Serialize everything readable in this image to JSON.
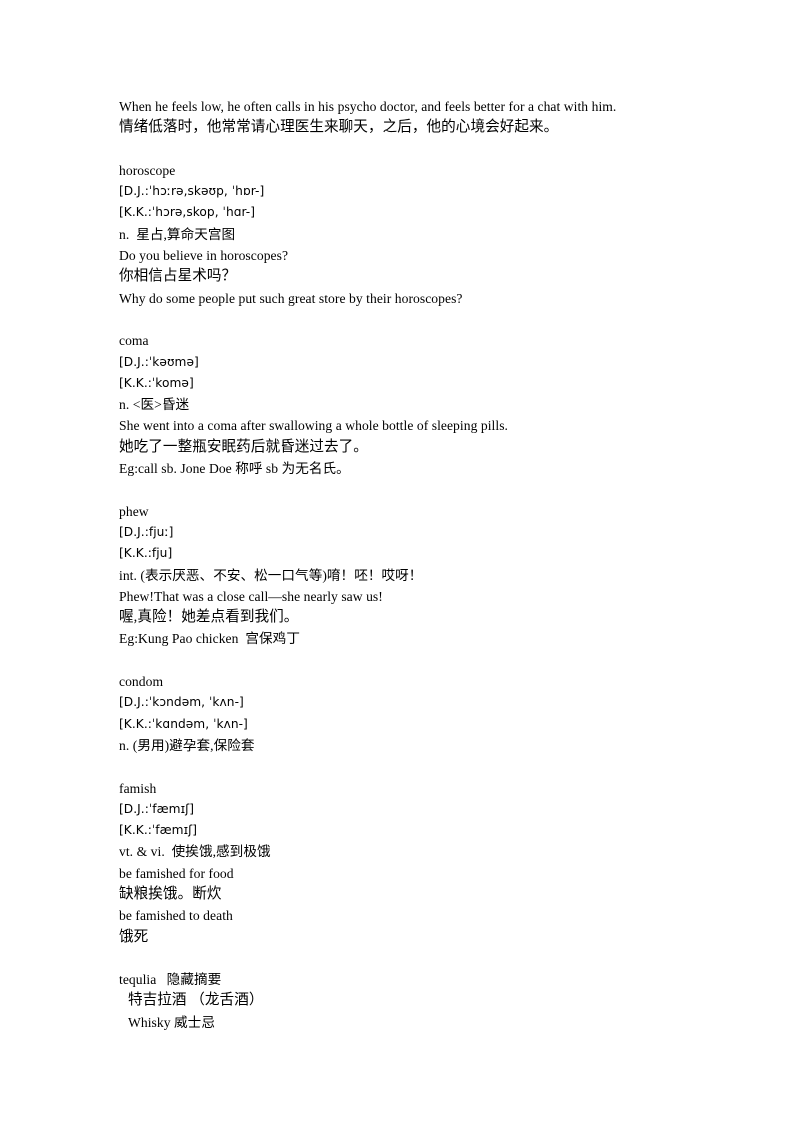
{
  "document": {
    "kind": "vocabulary-study-notes",
    "intro": {
      "english": "When he feels low, he often calls in his psycho doctor, and feels better for a chat with him.",
      "chinese": "情绪低落时，他常常请心理医生来聊天，之后，他的心境会好起来。"
    },
    "entries": [
      {
        "headword": "horoscope",
        "dj": "[D.J.:ˈhɔːrə,skəʊp, ˈhɒr-]",
        "kk": "[K.K.:ˈhɔrə,skop, ˈhɑr-]",
        "definition": "n.  星占,算命天宫图",
        "lines": [
          {
            "text": "Do you believe in horoscopes?",
            "script": "latin"
          },
          {
            "text": "你相信占星术吗？",
            "script": "cjk"
          },
          {
            "text": "Why do some people put such great store by their horoscopes?",
            "script": "latin"
          }
        ]
      },
      {
        "headword": "coma",
        "dj": "[D.J.:ˈkəʊmə]",
        "kk": "[K.K.:ˈkomə]",
        "definition": "n. <医>昏迷",
        "lines": [
          {
            "text": "She went into a coma after swallowing a whole bottle of sleeping pills.",
            "script": "latin"
          },
          {
            "text": "她吃了一整瓶安眠药后就昏迷过去了。",
            "script": "cjk"
          },
          {
            "text": "Eg:call sb. Jone Doe 称呼 sb 为无名氏。",
            "script": "mixed"
          }
        ]
      },
      {
        "headword": "phew",
        "dj": "[D.J.:fjuː]",
        "kk": "[K.K.:fju]",
        "definition": "int. (表示厌恶、不安、松一口气等)唷！呸！哎呀！",
        "lines": [
          {
            "text": "Phew!That was a close call—she nearly saw us!",
            "script": "latin"
          },
          {
            "text": "喔,真险！她差点看到我们。",
            "script": "cjk"
          },
          {
            "text": "Eg:Kung Pao chicken  宫保鸡丁",
            "script": "mixed"
          }
        ]
      },
      {
        "headword": "condom",
        "dj": "[D.J.:ˈkɔndəm, ˈkʌn-]",
        "kk": "[K.K.:ˈkɑndəm, ˈkʌn-]",
        "definition": "n. (男用)避孕套,保险套",
        "lines": []
      },
      {
        "headword": "famish",
        "dj": "[D.J.:ˈfæmɪʃ]",
        "kk": "[K.K.:ˈfæmɪʃ]",
        "definition": "vt. & vi.  使挨饿,感到极饿",
        "lines": [
          {
            "text": "be famished for food",
            "script": "latin"
          },
          {
            "text": "缺粮挨饿。断炊",
            "script": "cjk"
          },
          {
            "text": "be famished to death",
            "script": "latin"
          },
          {
            "text": "饿死",
            "script": "cjk"
          }
        ]
      }
    ],
    "final_block": {
      "heading": "tequlia   隐藏摘要",
      "lines": [
        {
          "text": "特吉拉酒 （龙舌酒）",
          "script": "cjk"
        },
        {
          "text": "Whisky 威士忌",
          "script": "mixed"
        }
      ]
    }
  }
}
